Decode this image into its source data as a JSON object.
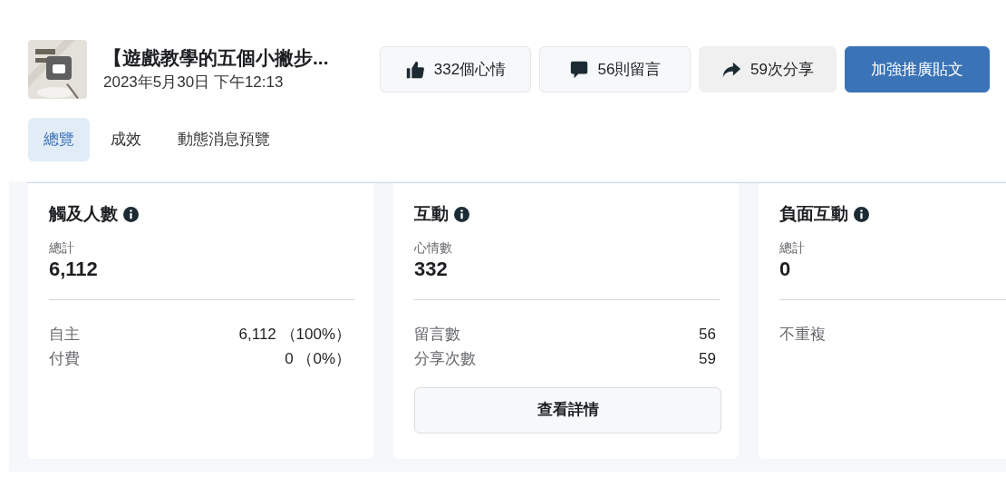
{
  "post": {
    "title": "【遊戲教學的五個小撇步...",
    "date": "2023年5月30日 下午12:13"
  },
  "actions": [
    {
      "kind": "like",
      "label": "332個心情"
    },
    {
      "kind": "comment",
      "label": "56則留言"
    },
    {
      "kind": "share",
      "label": "59次分享"
    },
    {
      "kind": "primary",
      "label": "加強推廣貼文"
    }
  ],
  "tabs": [
    {
      "label": "總覽",
      "selected": true
    },
    {
      "label": "成效",
      "selected": false
    },
    {
      "label": "動態消息預覽",
      "selected": false
    }
  ],
  "cards": [
    {
      "title": "觸及人數",
      "metric_label": "總計",
      "metric_value": "6,112",
      "rows": [
        {
          "label": "自主",
          "value": "6,112 （100%）"
        },
        {
          "label": "付費",
          "value": "0 （0%）"
        }
      ]
    },
    {
      "title": "互動",
      "metric_label": "心情數",
      "metric_value": "332",
      "rows": [
        {
          "label": "留言數",
          "value": "56"
        },
        {
          "label": "分享次數",
          "value": "59"
        }
      ],
      "button": "查看詳情"
    },
    {
      "title": "負面互動",
      "metric_label": "總計",
      "metric_value": "0",
      "rows": [
        {
          "label": "不重複"
        }
      ]
    }
  ]
}
